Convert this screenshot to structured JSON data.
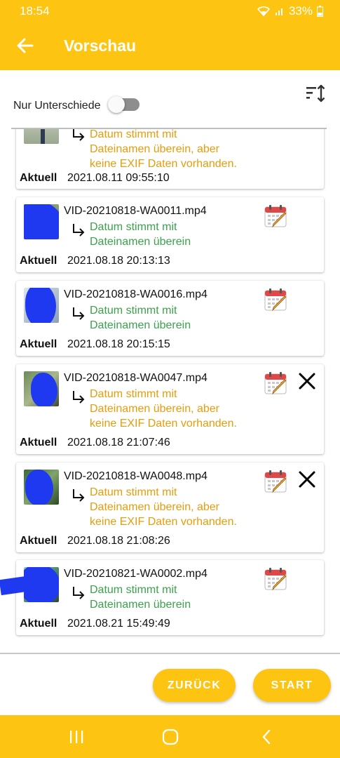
{
  "status_bar": {
    "time": "18:54",
    "battery": "33%"
  },
  "app_bar": {
    "title": "Vorschau",
    "back_icon": "arrow-left-icon"
  },
  "filter": {
    "label": "Nur Unterschiede",
    "toggle_on": false,
    "sort_icon": "sort-icon"
  },
  "list": {
    "current_label": "Aktuell",
    "items": [
      {
        "filename": "",
        "message": "Datum stimmt mit\nDateinamen überein, aber\nkeine EXIF Daten vorhanden.",
        "status": "warning",
        "current": "2021.08.11 09:55:10",
        "removable": false
      },
      {
        "filename": "VID-20210818-WA0011.mp4",
        "message": "Datum stimmt mit\nDateinamen überein",
        "status": "ok",
        "current": "2021.08.18 20:13:13",
        "removable": false
      },
      {
        "filename": "VID-20210818-WA0016.mp4",
        "message": "Datum stimmt mit\nDateinamen überein",
        "status": "ok",
        "current": "2021.08.18 20:15:15",
        "removable": false
      },
      {
        "filename": "VID-20210818-WA0047.mp4",
        "message": "Datum stimmt mit\nDateinamen überein, aber\nkeine EXIF Daten vorhanden.",
        "status": "warning",
        "current": "2021.08.18 21:07:46",
        "removable": true
      },
      {
        "filename": "VID-20210818-WA0048.mp4",
        "message": "Datum stimmt mit\nDateinamen überein, aber\nkeine EXIF Daten vorhanden.",
        "status": "warning",
        "current": "2021.08.18 21:08:26",
        "removable": true
      },
      {
        "filename": "VID-20210821-WA0002.mp4",
        "message": "Datum stimmt mit\nDateinamen überein",
        "status": "ok",
        "current": "2021.08.21 15:49:49",
        "removable": false
      }
    ]
  },
  "buttons": {
    "back": "ZURÜCK",
    "start": "START"
  },
  "colors": {
    "accent": "#FDC511",
    "ok": "#3BA24C",
    "warning": "#E89C0C",
    "close": "#000000"
  },
  "nav": {
    "recents_icon": "recents-icon",
    "home_icon": "home-icon",
    "back_icon": "back-chevron-icon"
  }
}
